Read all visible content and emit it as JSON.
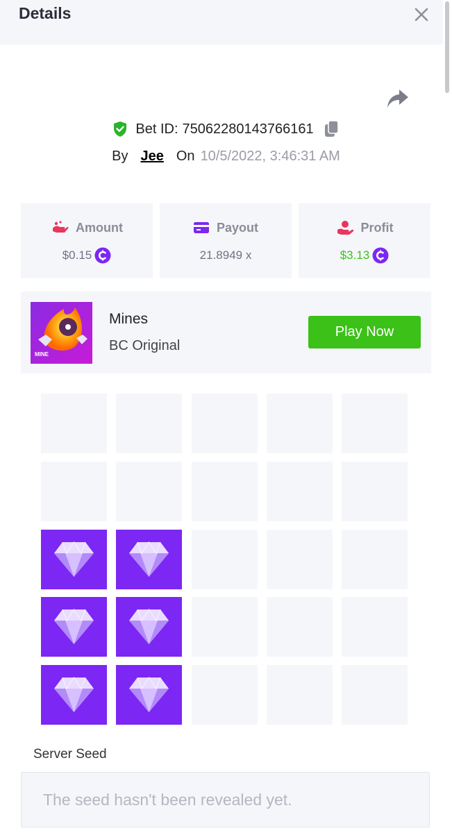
{
  "header": {
    "title": "Details"
  },
  "bet": {
    "id_label": "Bet ID:",
    "id": "75062280143766161",
    "by_label": "By",
    "user": "Jee",
    "on_label": "On",
    "date": "10/5/2022, 3:46:31 AM"
  },
  "stats": {
    "amount": {
      "label": "Amount",
      "value": "$0.15"
    },
    "payout": {
      "label": "Payout",
      "value": "21.8949 x"
    },
    "profit": {
      "label": "Profit",
      "value": "$3.13"
    }
  },
  "game": {
    "name": "Mines",
    "provider": "BC Original",
    "thumb_label": "MINE",
    "play_label": "Play Now"
  },
  "board": {
    "rows": 5,
    "cols": 5,
    "gems": [
      [
        2,
        0
      ],
      [
        2,
        1
      ],
      [
        3,
        0
      ],
      [
        3,
        1
      ],
      [
        4,
        0
      ],
      [
        4,
        1
      ]
    ]
  },
  "seed": {
    "label": "Server Seed",
    "placeholder": "The seed hasn't been revealed yet."
  },
  "colors": {
    "accent_green": "#3bc117",
    "gem_purple": "#7c27f3",
    "panel_bg": "#f5f6fa"
  }
}
